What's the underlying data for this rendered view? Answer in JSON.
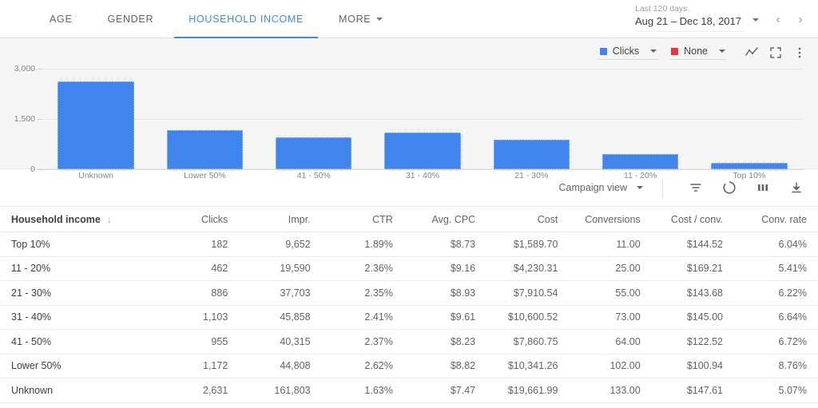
{
  "tabs": [
    {
      "label": "AGE",
      "active": false,
      "caret": false
    },
    {
      "label": "GENDER",
      "active": false,
      "caret": false
    },
    {
      "label": "HOUSEHOLD INCOME",
      "active": true,
      "caret": false
    },
    {
      "label": "MORE",
      "active": false,
      "caret": true
    }
  ],
  "date_range": {
    "preset_label": "Last 120 days",
    "value": "Aug 21 – Dec 18, 2017",
    "prev_label": "‹",
    "next_label": "›"
  },
  "chart_toolbar": {
    "primary_metric": {
      "label": "Clicks",
      "color": "#3f85ed"
    },
    "secondary_metric": {
      "label": "None",
      "color": "#e53935"
    }
  },
  "table_toolbar": {
    "view_label": "Campaign view"
  },
  "table": {
    "columns": [
      "Household income",
      "Clicks",
      "Impr.",
      "CTR",
      "Avg. CPC",
      "Cost",
      "Conversions",
      "Cost / conv.",
      "Conv. rate"
    ],
    "sort_column": "Household income",
    "sort_indicator": "↓",
    "rows": [
      [
        "Top 10%",
        "182",
        "9,652",
        "1.89%",
        "$8.73",
        "$1,589.70",
        "11.00",
        "$144.52",
        "6.04%"
      ],
      [
        "11 - 20%",
        "462",
        "19,590",
        "2.36%",
        "$9.16",
        "$4,230.31",
        "25.00",
        "$169.21",
        "5.41%"
      ],
      [
        "21 - 30%",
        "886",
        "37,703",
        "2.35%",
        "$8.93",
        "$7,910.54",
        "55.00",
        "$143.68",
        "6.22%"
      ],
      [
        "31 - 40%",
        "1,103",
        "45,858",
        "2.41%",
        "$9.61",
        "$10,600.52",
        "73.00",
        "$145.00",
        "6.64%"
      ],
      [
        "41 - 50%",
        "955",
        "40,315",
        "2.37%",
        "$8.23",
        "$7,860.75",
        "64.00",
        "$122.52",
        "6.72%"
      ],
      [
        "Lower 50%",
        "1,172",
        "44,808",
        "2.62%",
        "$8.82",
        "$10,341.26",
        "102.00",
        "$100.94",
        "8.76%"
      ],
      [
        "Unknown",
        "2,631",
        "161,803",
        "1.63%",
        "$7.47",
        "$19,661.99",
        "133.00",
        "$147.61",
        "5.07%"
      ]
    ]
  },
  "chart_data": {
    "type": "bar",
    "title": "",
    "xlabel": "",
    "ylabel": "",
    "categories": [
      "Unknown",
      "Lower 50%",
      "41 - 50%",
      "31 - 40%",
      "21 - 30%",
      "11 - 20%",
      "Top 10%"
    ],
    "series": [
      {
        "name": "Clicks",
        "color": "#3f85ed",
        "values": [
          2631,
          1172,
          955,
          1103,
          886,
          462,
          182
        ]
      }
    ],
    "ylim": [
      0,
      3000
    ],
    "yticks": [
      0,
      1500,
      3000
    ],
    "ytick_labels": [
      "0",
      "1,500",
      "3,000"
    ],
    "grid": true,
    "legend": "none"
  }
}
